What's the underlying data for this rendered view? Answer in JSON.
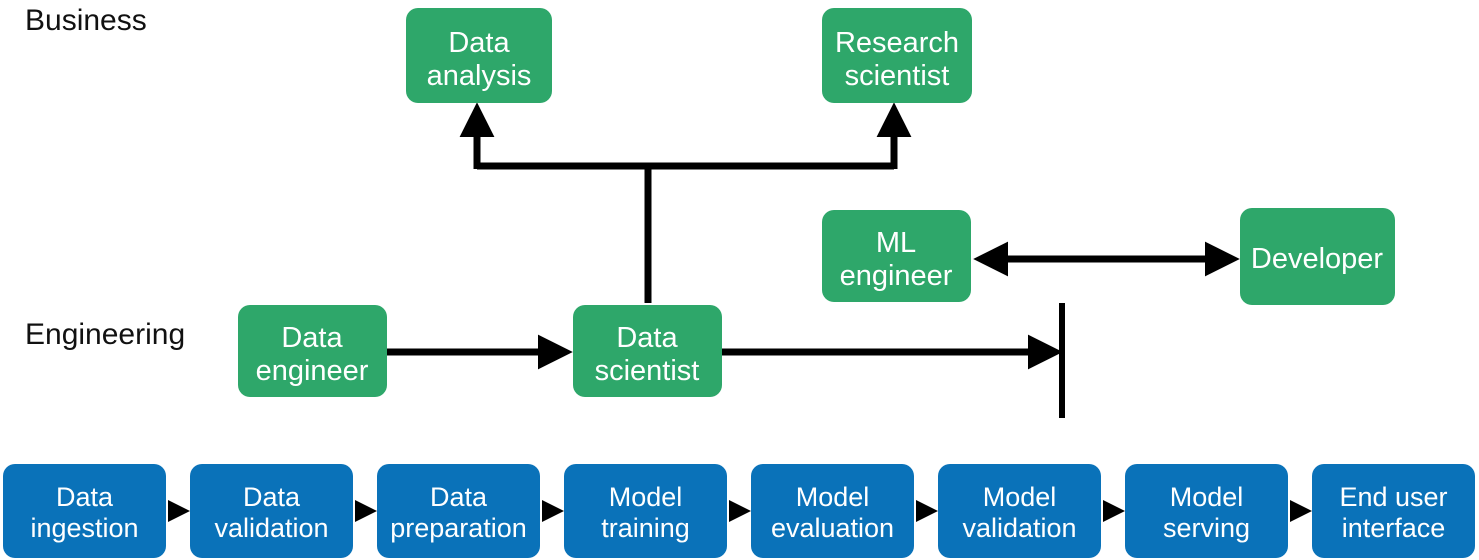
{
  "diagram": {
    "title_lanes": [
      {
        "id": "business",
        "label": "Business"
      },
      {
        "id": "engineering",
        "label": "Engineering"
      }
    ],
    "colors": {
      "green": "#2ea76a",
      "blue": "#0a72b9",
      "connector": "#000000",
      "node_text": "#ffffff",
      "lane_label": "#111111",
      "background": "#ffffff"
    },
    "roles": {
      "data_analysis": {
        "line1": "Data",
        "line2": "analysis"
      },
      "research_scientist": {
        "line1": "Research",
        "line2": "scientist"
      },
      "ml_engineer": {
        "line1": "ML",
        "line2": "engineer"
      },
      "developer": {
        "line1": "Developer",
        "line2": ""
      },
      "data_engineer": {
        "line1": "Data",
        "line2": "engineer"
      },
      "data_scientist": {
        "line1": "Data",
        "line2": "scientist"
      }
    },
    "pipeline": {
      "stages": [
        {
          "line1": "Data",
          "line2": "ingestion"
        },
        {
          "line1": "Data",
          "line2": "validation"
        },
        {
          "line1": "Data",
          "line2": "preparation"
        },
        {
          "line1": "Model",
          "line2": "training"
        },
        {
          "line1": "Model",
          "line2": "evaluation"
        },
        {
          "line1": "Model",
          "line2": "validation"
        },
        {
          "line1": "Model",
          "line2": "serving"
        },
        {
          "line1": "End user",
          "line2": "interface"
        }
      ]
    }
  }
}
